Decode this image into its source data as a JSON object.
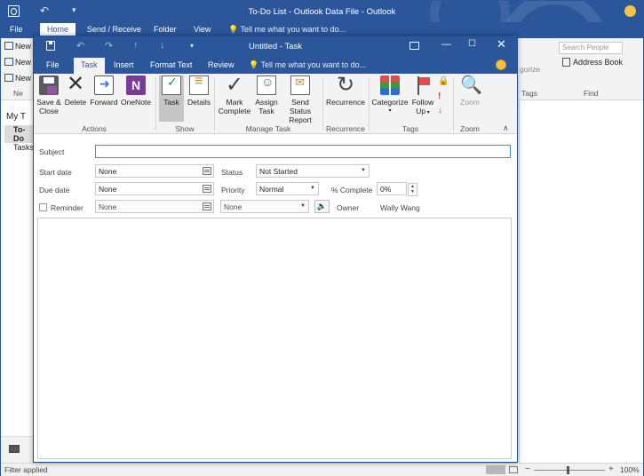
{
  "outer": {
    "title": "To-Do List - Outlook Data File - Outlook",
    "tabs": [
      "File",
      "Home",
      "Send / Receive",
      "Folder",
      "View"
    ],
    "tell_me": "Tell me what you want to do...",
    "left_buttons": [
      "New",
      "New",
      "New"
    ],
    "nav": {
      "my_tasks": "My T",
      "todo": "To-Do",
      "tasks": "Tasks"
    },
    "search_people_placeholder": "Search People",
    "address_book": "Address Book",
    "categorize_partial": "gorize",
    "group_tags": "Tags",
    "group_find": "Find",
    "group_left": "Ne",
    "status": {
      "filter": "Filter applied",
      "zoom": "100%"
    }
  },
  "task_window": {
    "title": "Untitled - Task",
    "tabs": [
      "File",
      "Task",
      "Insert",
      "Format Text",
      "Review"
    ],
    "tell_me": "Tell me what you want to do...",
    "ribbon": {
      "actions": {
        "save_close_line1": "Save &",
        "save_close_line2": "Close",
        "delete": "Delete",
        "forward": "Forward",
        "onenote": "OneNote",
        "label": "Actions"
      },
      "show": {
        "task": "Task",
        "details": "Details",
        "label": "Show"
      },
      "manage": {
        "mark_complete_line1": "Mark",
        "mark_complete_line2": "Complete",
        "assign_task_line1": "Assign",
        "assign_task_line2": "Task",
        "send_status_line1": "Send Status",
        "send_status_line2": "Report",
        "label": "Manage Task"
      },
      "recurrence": {
        "recurrence": "Recurrence",
        "label": "Recurrence"
      },
      "tags": {
        "categorize": "Categorize",
        "follow_up_line1": "Follow",
        "follow_up_line2": "Up",
        "label": "Tags"
      },
      "zoom": {
        "zoom": "Zoom",
        "label": "Zoom"
      }
    },
    "form": {
      "subject_label": "Subject",
      "subject_value": "",
      "start_date_label": "Start date",
      "start_date_value": "None",
      "due_date_label": "Due date",
      "due_date_value": "None",
      "reminder_label": "Reminder",
      "reminder_date_value": "None",
      "reminder_time_value": "None",
      "status_label": "Status",
      "status_value": "Not Started",
      "priority_label": "Priority",
      "priority_value": "Normal",
      "percent_label": "% Complete",
      "percent_value": "0%",
      "owner_label": "Owner",
      "owner_value": "Wally Wang"
    }
  }
}
